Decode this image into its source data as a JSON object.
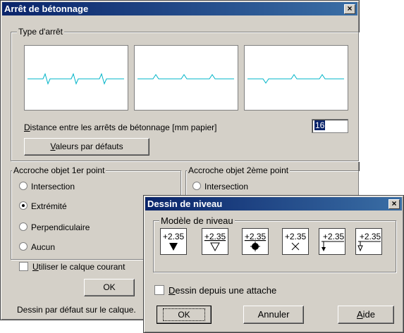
{
  "main_dialog": {
    "title": "Arrêt de bétonnage",
    "type_group_label": "Type d'arrêt",
    "distance_label_mnemonic": "D",
    "distance_label_rest": "istance entre les arrêts de bétonnage [mm papier]",
    "distance_value": "16",
    "defaults_button_mnemonic": "V",
    "defaults_button_rest": "aleurs par défauts",
    "snap1": {
      "label": "Accroche objet 1er point",
      "options": [
        "Intersection",
        "Extrémité",
        "Perpendiculaire",
        "Aucun"
      ],
      "selected": "Extrémité"
    },
    "snap2": {
      "label": "Accroche objet 2ème point",
      "options": [
        "Intersection"
      ]
    },
    "use_layer_mnemonic": "U",
    "use_layer_rest": "tiliser le calque courant",
    "ok_label": "OK",
    "status_text": "Dessin par défaut sur le calque."
  },
  "level_dialog": {
    "title": "Dessin de niveau",
    "model_group_label": "Modèle de niveau",
    "level_value": "+2.35",
    "checkbox_mnemonic": "D",
    "checkbox_rest": "essin depuis une attache",
    "ok_label": "OK",
    "cancel_label": "Annuler",
    "help_mnemonic": "A",
    "help_rest": "ide"
  },
  "colors": {
    "titlebar_start": "#0a246a",
    "titlebar_end": "#3a6ea5",
    "dialog_face": "#d4d0c8",
    "preview_line": "#00b4c8"
  },
  "icons": [
    "close-icon",
    "level-marker-icon"
  ]
}
